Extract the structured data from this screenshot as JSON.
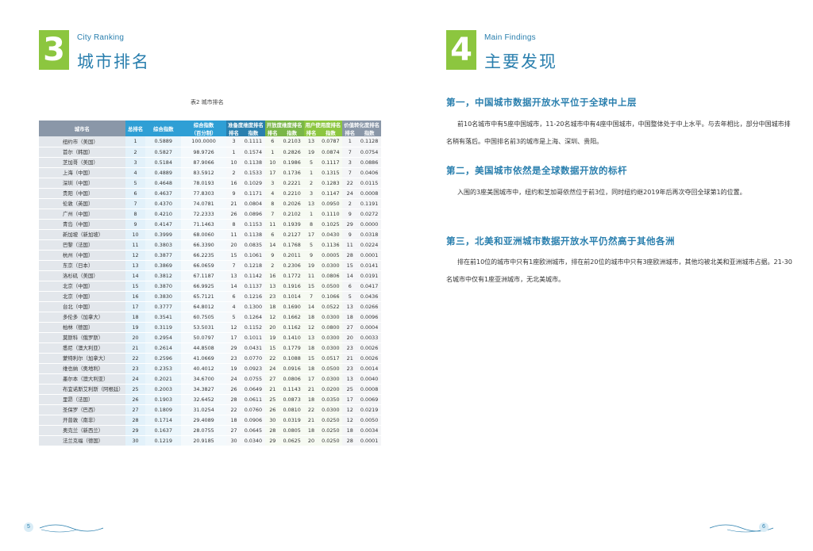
{
  "left": {
    "section_number": "3",
    "section_en": "City Ranking",
    "section_cn": "城市排名",
    "table_caption": "表2 城市排名",
    "page_number": "5"
  },
  "table": {
    "headers": {
      "city": "城市名",
      "rank": "总排名",
      "score": "综合指数",
      "index": "综合指数",
      "index_sub": "（百分制）",
      "g1": "准备度维度排名",
      "g2": "开放度维度排名",
      "g3": "用户使用度排名",
      "g4": "价值转化度排名",
      "rank_sub": "排名",
      "idx_sub": "指数"
    },
    "rows": [
      [
        "纽约市（美国）",
        "1",
        "0.5889",
        "100.0000",
        "3",
        "0.1111",
        "6",
        "0.2103",
        "13",
        "0.0787",
        "1",
        "0.1128"
      ],
      [
        "首尔（韩国）",
        "2",
        "0.5827",
        "98.9726",
        "1",
        "0.1574",
        "1",
        "0.2826",
        "19",
        "0.0874",
        "7",
        "0.0754"
      ],
      [
        "芝加哥（美国）",
        "3",
        "0.5184",
        "87.9066",
        "10",
        "0.1138",
        "10",
        "0.1986",
        "5",
        "0.1117",
        "3",
        "0.0886"
      ],
      [
        "上海（中国）",
        "4",
        "0.4889",
        "83.5912",
        "2",
        "0.1533",
        "17",
        "0.1736",
        "1",
        "0.1315",
        "7",
        "0.0406"
      ],
      [
        "深圳（中国）",
        "5",
        "0.4648",
        "78.0193",
        "16",
        "0.1029",
        "3",
        "0.2221",
        "2",
        "0.1283",
        "22",
        "0.0115"
      ],
      [
        "贵阳（中国）",
        "6",
        "0.4637",
        "77.8303",
        "9",
        "0.1171",
        "4",
        "0.2210",
        "3",
        "0.1147",
        "24",
        "0.0008"
      ],
      [
        "伦敦（英国）",
        "7",
        "0.4370",
        "74.0781",
        "21",
        "0.0804",
        "8",
        "0.2026",
        "13",
        "0.0950",
        "2",
        "0.1191"
      ],
      [
        "广州（中国）",
        "8",
        "0.4210",
        "72.2333",
        "26",
        "0.0896",
        "7",
        "0.2102",
        "1",
        "0.1110",
        "9",
        "0.0272"
      ],
      [
        "青岛（中国）",
        "9",
        "0.4147",
        "71.1463",
        "8",
        "0.1153",
        "11",
        "0.1939",
        "8",
        "0.1025",
        "29",
        "0.0000"
      ],
      [
        "新加坡（新加坡）",
        "10",
        "0.3999",
        "68.0060",
        "11",
        "0.1138",
        "6",
        "0.2127",
        "17",
        "0.0430",
        "9",
        "0.0318"
      ],
      [
        "巴黎（法国）",
        "11",
        "0.3803",
        "66.3390",
        "20",
        "0.0835",
        "14",
        "0.1768",
        "5",
        "0.1136",
        "11",
        "0.0224"
      ],
      [
        "杭州（中国）",
        "12",
        "0.3877",
        "66.2235",
        "15",
        "0.1061",
        "9",
        "0.2011",
        "9",
        "0.0005",
        "28",
        "0.0001"
      ],
      [
        "东京（日本）",
        "13",
        "0.3869",
        "66.0659",
        "7",
        "0.1218",
        "2",
        "0.2306",
        "19",
        "0.0300",
        "15",
        "0.0141"
      ],
      [
        "洛杉矶（美国）",
        "14",
        "0.3812",
        "67.1187",
        "13",
        "0.1142",
        "16",
        "0.1772",
        "11",
        "0.0806",
        "14",
        "0.0191"
      ],
      [
        "北京（中国）",
        "15",
        "0.3870",
        "66.9925",
        "14",
        "0.1137",
        "13",
        "0.1916",
        "15",
        "0.0500",
        "6",
        "0.0417"
      ],
      [
        "北京（中国）",
        "16",
        "0.3830",
        "65.7121",
        "6",
        "0.1216",
        "23",
        "0.1014",
        "7",
        "0.1066",
        "5",
        "0.0436"
      ],
      [
        "台北（中国）",
        "17",
        "0.3777",
        "64.8012",
        "4",
        "0.1300",
        "18",
        "0.1690",
        "14",
        "0.0522",
        "13",
        "0.0266"
      ],
      [
        "多伦多（加拿大）",
        "18",
        "0.3541",
        "60.7505",
        "5",
        "0.1264",
        "12",
        "0.1662",
        "18",
        "0.0300",
        "18",
        "0.0096"
      ],
      [
        "柏林（德国）",
        "19",
        "0.3119",
        "53.5031",
        "12",
        "0.1152",
        "20",
        "0.1162",
        "12",
        "0.0800",
        "27",
        "0.0004"
      ],
      [
        "莫斯科（俄罗斯）",
        "20",
        "0.2954",
        "50.0797",
        "17",
        "0.1011",
        "19",
        "0.1410",
        "13",
        "0.0300",
        "20",
        "0.0033"
      ],
      [
        "悉尼（澳大利亚）",
        "21",
        "0.2614",
        "44.8508",
        "29",
        "0.0431",
        "15",
        "0.1779",
        "18",
        "0.0300",
        "23",
        "0.0026"
      ],
      [
        "蒙特利尔（加拿大）",
        "22",
        "0.2596",
        "41.0669",
        "23",
        "0.0770",
        "22",
        "0.1088",
        "15",
        "0.0517",
        "21",
        "0.0026"
      ],
      [
        "维也纳（奥地利）",
        "23",
        "0.2353",
        "40.4012",
        "19",
        "0.0923",
        "24",
        "0.0916",
        "18",
        "0.0500",
        "23",
        "0.0014"
      ],
      [
        "墨尔本（澳大利亚）",
        "24",
        "0.2021",
        "34.6700",
        "24",
        "0.0755",
        "27",
        "0.0806",
        "17",
        "0.0300",
        "13",
        "0.0040"
      ],
      [
        "布宜诺斯艾利斯（阿根廷）",
        "25",
        "0.2003",
        "34.3827",
        "26",
        "0.0649",
        "21",
        "0.1143",
        "21",
        "0.0200",
        "25",
        "0.0008"
      ],
      [
        "里昂（法国）",
        "26",
        "0.1903",
        "32.6452",
        "28",
        "0.0611",
        "25",
        "0.0873",
        "18",
        "0.0350",
        "17",
        "0.0069"
      ],
      [
        "圣保罗（巴西）",
        "27",
        "0.1809",
        "31.0254",
        "22",
        "0.0760",
        "26",
        "0.0810",
        "22",
        "0.0300",
        "12",
        "0.0219"
      ],
      [
        "开普敦（南非）",
        "28",
        "0.1714",
        "29.4089",
        "18",
        "0.0906",
        "30",
        "0.0319",
        "21",
        "0.0250",
        "12",
        "0.0050"
      ],
      [
        "奥克兰（新西兰）",
        "29",
        "0.1637",
        "28.0755",
        "27",
        "0.0645",
        "28",
        "0.0805",
        "18",
        "0.0250",
        "18",
        "0.0034"
      ],
      [
        "法兰克福（德国）",
        "30",
        "0.1219",
        "20.9185",
        "30",
        "0.0340",
        "29",
        "0.0625",
        "20",
        "0.0250",
        "28",
        "0.0001"
      ]
    ]
  },
  "right": {
    "section_number": "4",
    "section_en": "Main Findings",
    "section_cn": "主要发现",
    "page_number": "6",
    "findings": [
      {
        "title": "第一，中国城市数据开放水平位于全球中上层",
        "body": "前10名城市中有5座中国城市，11-20名城市中有4座中国城市，中国整体处于中上水平。与去年相比，部分中国城市排名稍有落后。中国排名前3的城市是上海、深圳、贵阳。"
      },
      {
        "title": "第二，美国城市依然是全球数据开放的标杆",
        "body": "入围的3座美国城市中，纽约和芝加哥依然位于前3位，同时纽约继2019年后再次夺回全球第1的位置。"
      },
      {
        "title": "第三，北美和亚洲城市数据开放水平仍然高于其他各洲",
        "body": "排在前10位的城市中只有1座欧洲城市，排在前20位的城市中只有3座欧洲城市，其他均被北美和亚洲城市占据。21-30名城市中仅有1座亚洲城市，无北美城市。"
      }
    ]
  }
}
